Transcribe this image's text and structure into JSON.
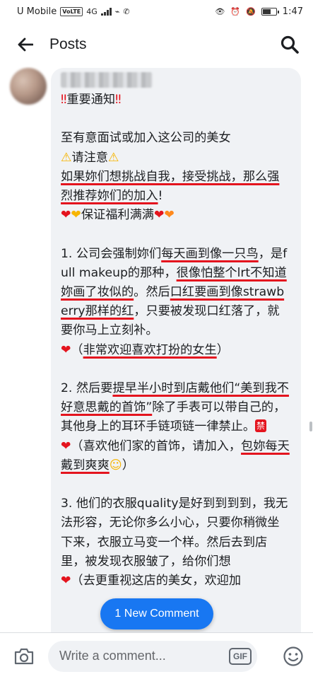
{
  "status_bar": {
    "carrier": "U Mobile",
    "volte": "VoLTE",
    "network": "4G",
    "time": "1:47",
    "battery_level": 0.6
  },
  "header": {
    "title": "Posts",
    "back_icon": "arrow-left-icon",
    "search_icon": "search-icon"
  },
  "post": {
    "title": "重要通知",
    "p1_line1": "至有意面试或加入这公司的美女",
    "p1_warn": "请注意",
    "p1_h1": "如果妳们想挑战自我，接受挑战，那么强烈推荐妳们的加入",
    "p1_end": "!",
    "p1_benefit": "保证福利满满",
    "s1_a": "1. 公司会强制妳们",
    "s1_h1": "每天画到像一只鸟",
    "s1_b": "，是full makeup的那种，",
    "s1_h2": "很像怕整个lrt不知道妳画了妆似的",
    "s1_c": "。然后",
    "s1_h3": "口红要画到像strawberry那样的红",
    "s1_d": "，只要被发现口红落了，就要你马上立刻补。",
    "s1_paren_open": "（",
    "s1_h4": "非常欢迎喜欢打扮的女生",
    "s1_paren_close": "）",
    "s2_a": "2. 然后要",
    "s2_h1": "提早半小时到店戴他们“美到我不好意思戴的首饰”",
    "s2_b": "除了手表可以带自己的，其他身上的耳环手链项链一律禁止。",
    "s2_ban": "禁",
    "s2_c": "（喜欢他们家的首饰，请加入，",
    "s2_h2": "包妳每天戴到爽爽",
    "s2_d": "）",
    "s3_a": "3. 他们的衣服quality是好到到到到，我无法形容，无论你多么小心，只要你稍微坐下来，衣服立马变一个样。然后去到店里，被发现衣服皱了，给你们想",
    "s3_b": "（去更重视这店的美女，欢迎加"
  },
  "new_comment_label": "1 New Comment",
  "comment_bar": {
    "placeholder": "Write a comment...",
    "gif_label": "GIF"
  },
  "colors": {
    "accent": "#1877f2",
    "underline": "#e4141e",
    "bubble": "#f0f2f5"
  }
}
